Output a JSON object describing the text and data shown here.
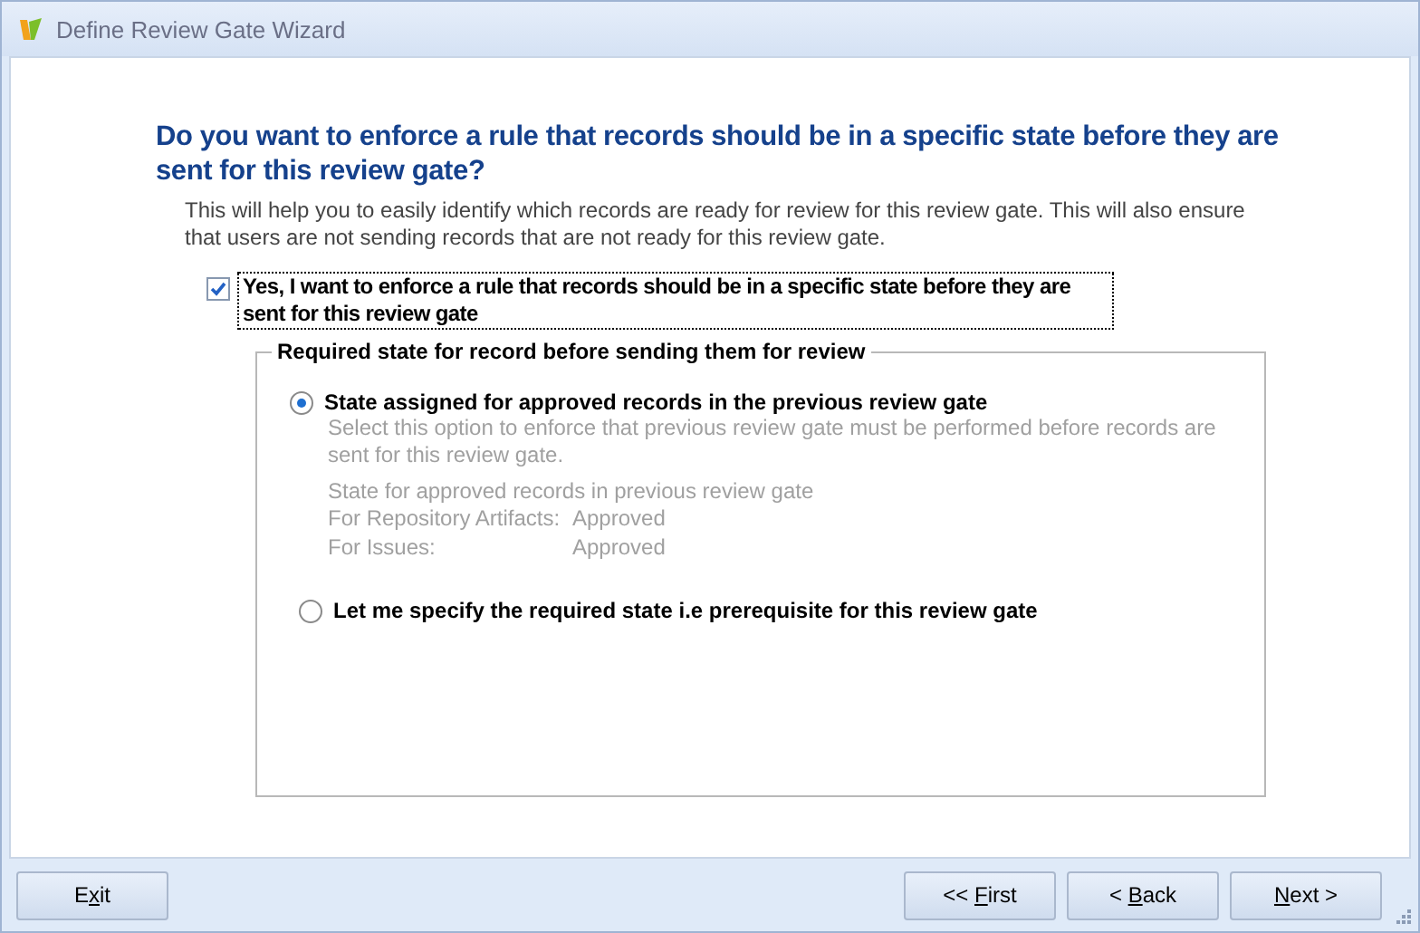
{
  "window": {
    "title": "Define Review Gate Wizard"
  },
  "heading": "Do you want to enforce a rule that records should be in a specific state before they are sent for this review gate?",
  "description": "This will help you to easily identify which records are ready for review for this review gate. This will also ensure that users are not sending records that are not ready for this review gate.",
  "enforce_checkbox": {
    "label": "Yes, I want to enforce a rule that records should be in a specific state before they are sent for this review gate",
    "checked": true
  },
  "group": {
    "title": "Required state for record before sending them for review",
    "options": [
      {
        "label": "State assigned for approved records in the previous review gate",
        "selected": true,
        "hint": "Select this option to enforce that previous review gate must be performed before records are sent for this review gate.",
        "details_title": "State for approved records in previous review gate",
        "details": [
          {
            "label": "For Repository Artifacts:",
            "value": "Approved"
          },
          {
            "label": "For Issues:",
            "value": "Approved"
          }
        ]
      },
      {
        "label": "Let me specify the required state i.e prerequisite for this review gate",
        "selected": false
      }
    ]
  },
  "footer": {
    "left_buttons": [
      {
        "pre": "E",
        "key": "x",
        "post": "it"
      }
    ],
    "right_buttons": [
      {
        "pre": "<< ",
        "key": "F",
        "post": "irst"
      },
      {
        "pre": "< ",
        "key": "B",
        "post": "ack"
      },
      {
        "key": "N",
        "post": "ext >"
      }
    ]
  }
}
